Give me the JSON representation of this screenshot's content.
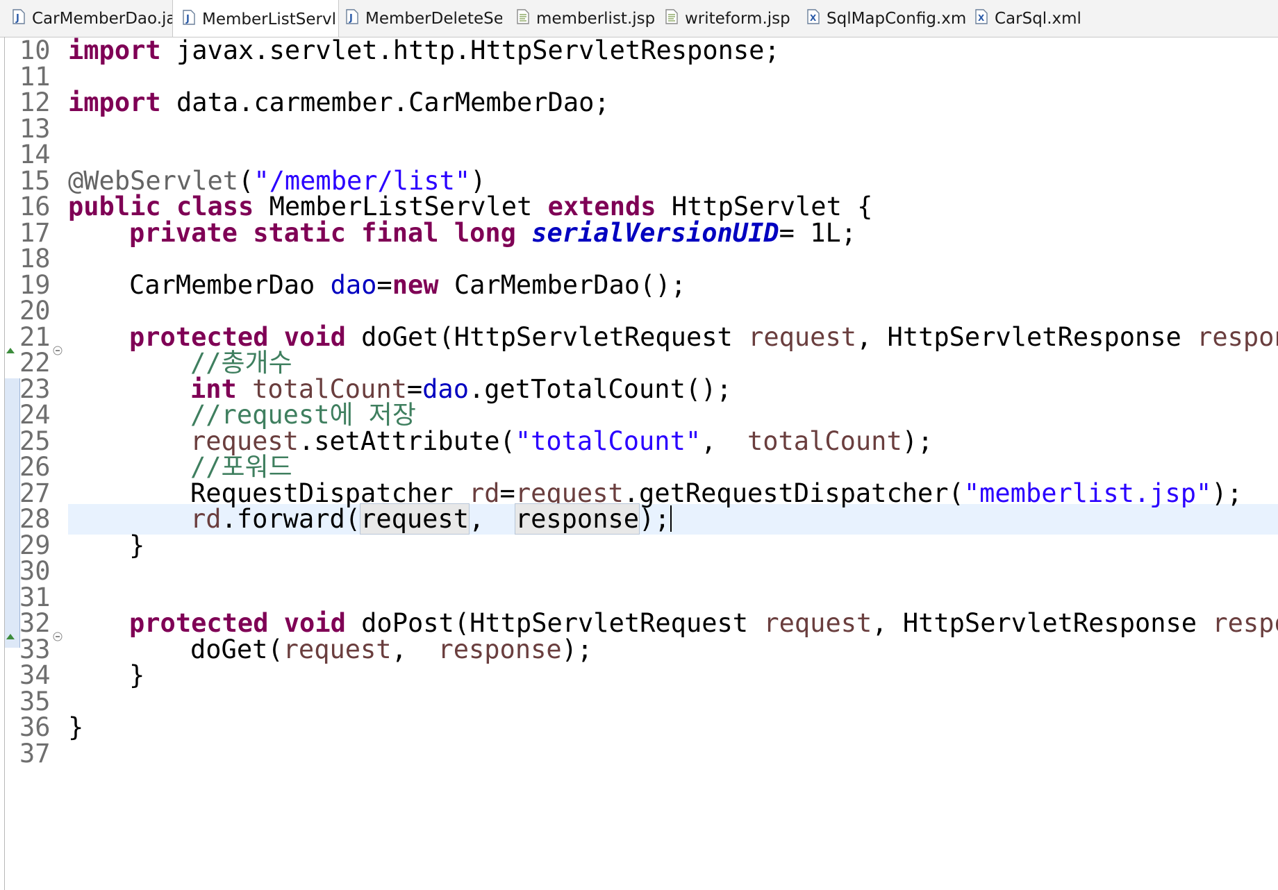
{
  "tabs": [
    {
      "label": "CarMemberDao.ja",
      "icon": "java-file-icon",
      "active": false
    },
    {
      "label": "MemberListServl",
      "icon": "java-file-icon",
      "active": true
    },
    {
      "label": "MemberDeleteSer",
      "icon": "java-file-icon",
      "active": false
    },
    {
      "label": "memberlist.jsp",
      "icon": "jsp-file-icon",
      "active": false
    },
    {
      "label": "writeform.jsp",
      "icon": "jsp-file-icon",
      "active": false
    },
    {
      "label": "SqlMapConfig.xm",
      "icon": "xml-file-icon",
      "active": false
    },
    {
      "label": "CarSql.xml",
      "icon": "xml-file-icon",
      "active": false
    }
  ],
  "editor": {
    "lines": [
      {
        "num": "10",
        "t": [
          [
            "kw",
            "import"
          ],
          [
            "",
            "javax.servlet.http.HttpServletResponse;"
          ]
        ]
      },
      {
        "num": "11",
        "t": []
      },
      {
        "num": "12",
        "t": [
          [
            "kw",
            "import"
          ],
          [
            "",
            "data.carmember.CarMemberDao;"
          ]
        ]
      },
      {
        "num": "13",
        "t": []
      },
      {
        "num": "14",
        "t": []
      },
      {
        "num": "15",
        "t": [
          [
            "ann",
            "@WebServlet"
          ],
          [
            "",
            "("
          ],
          [
            "str",
            "\"/member/list\""
          ],
          [
            "",
            ")"
          ]
        ]
      },
      {
        "num": "16",
        "t": [
          [
            "kw",
            "public"
          ],
          [
            "kw",
            "class"
          ],
          [
            "",
            "MemberListServlet"
          ],
          [
            "kw",
            "extends"
          ],
          [
            "",
            "HttpServlet {"
          ]
        ]
      },
      {
        "num": "17",
        "t": [
          [
            "kw",
            "private"
          ],
          [
            "kw",
            "static"
          ],
          [
            "kw",
            "final"
          ],
          [
            "kw",
            "long"
          ],
          [
            "sfld",
            "serialVersionUID"
          ],
          [
            "",
            "= 1L;"
          ]
        ]
      },
      {
        "num": "18",
        "t": []
      },
      {
        "num": "19",
        "t": [
          [
            "",
            "CarMemberDao"
          ],
          [
            "fld",
            "dao"
          ],
          [
            "",
            "="
          ],
          [
            "kw",
            "new"
          ],
          [
            "",
            "CarMemberDao();"
          ]
        ]
      },
      {
        "num": "20",
        "t": []
      },
      {
        "num": "21",
        "t": [
          [
            "kw",
            "protected"
          ],
          [
            "kw",
            "void"
          ],
          [
            "",
            "doGet(HttpServletRequest"
          ],
          [
            "var",
            "request"
          ],
          [
            "",
            ", HttpServletResponse"
          ],
          [
            "var",
            "response"
          ]
        ]
      },
      {
        "num": "22",
        "t": [
          [
            "cmt",
            "//총개수"
          ]
        ]
      },
      {
        "num": "23",
        "t": [
          [
            "kw",
            "int"
          ],
          [
            "var",
            "totalCount"
          ],
          [
            "",
            "="
          ],
          [
            "fld",
            "dao"
          ],
          [
            "",
            ".getTotalCount();"
          ]
        ]
      },
      {
        "num": "24",
        "t": [
          [
            "cmt",
            "//request에 저장"
          ]
        ]
      },
      {
        "num": "25",
        "t": [
          [
            "var",
            "request"
          ],
          [
            "",
            ".setAttribute("
          ],
          [
            "str",
            "\"totalCount\""
          ],
          [
            "",
            ", "
          ],
          [
            "var",
            "totalCount"
          ],
          [
            "",
            ");"
          ]
        ]
      },
      {
        "num": "26",
        "t": [
          [
            "cmt",
            "//포워드"
          ]
        ]
      },
      {
        "num": "27",
        "t": [
          [
            "",
            "RequestDispatcher"
          ],
          [
            "var",
            "rd"
          ],
          [
            "",
            "="
          ],
          [
            "var",
            "request"
          ],
          [
            "",
            ".getRequestDispatcher("
          ],
          [
            "str",
            "\"memberlist.jsp\""
          ],
          [
            "",
            ");"
          ]
        ]
      },
      {
        "num": "28",
        "t": [
          [
            "var",
            "rd"
          ],
          [
            "",
            ".forward("
          ],
          [
            "occ",
            "request"
          ],
          [
            "",
            ", "
          ],
          [
            "occ",
            "response"
          ],
          [
            "",
            ");"
          ]
        ]
      },
      {
        "num": "29",
        "t": [
          [
            "",
            "}"
          ]
        ]
      },
      {
        "num": "30",
        "t": []
      },
      {
        "num": "31",
        "t": []
      },
      {
        "num": "32",
        "t": [
          [
            "kw",
            "protected"
          ],
          [
            "kw",
            "void"
          ],
          [
            "",
            "doPost(HttpServletRequest"
          ],
          [
            "var",
            "request"
          ],
          [
            "",
            ", HttpServletResponse"
          ],
          [
            "var",
            "respons"
          ]
        ]
      },
      {
        "num": "33",
        "t": [
          [
            "",
            "doGet("
          ],
          [
            "var",
            "request"
          ],
          [
            "",
            ", "
          ],
          [
            "var",
            "response"
          ],
          [
            "",
            ");"
          ]
        ]
      },
      {
        "num": "34",
        "t": [
          [
            "",
            "}"
          ]
        ]
      },
      {
        "num": "35",
        "t": []
      },
      {
        "num": "36",
        "t": [
          [
            "",
            "}"
          ]
        ]
      },
      {
        "num": "37",
        "t": []
      }
    ]
  }
}
